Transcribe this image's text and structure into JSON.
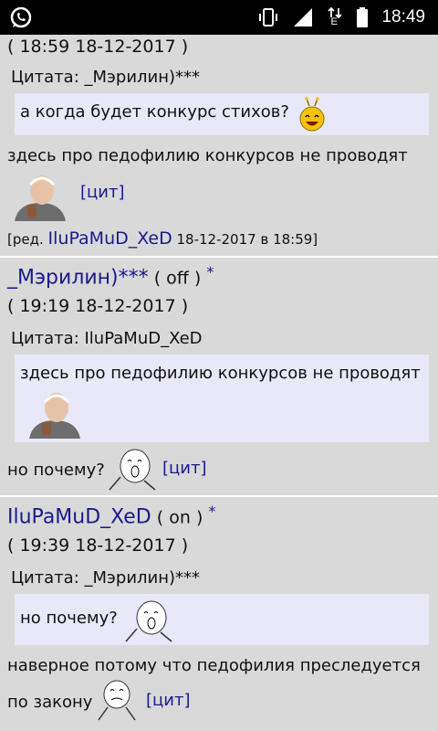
{
  "status_bar": {
    "time": "18:49",
    "icons": [
      "whatsapp-icon",
      "vibrate-icon",
      "signal-icon",
      "data-arrows-icon",
      "battery-icon"
    ],
    "network_letter": "E"
  },
  "posts": [
    {
      "datetime": "( 18:59 18-12-2017 )",
      "quote_label": "Цитата: _Мэрилин)***",
      "quote_text": "а когда будет конкурс стихов?",
      "body": "здесь про педофилию конкурсов не проводят",
      "cit": "[цит]",
      "edit_prefix": "[ред. ",
      "edit_user": "IluPaMuD_XeD",
      "edit_date": " 18-12-2017 в 18:59]"
    },
    {
      "author": "_Мэрилин)***",
      "online": "( off )",
      "star": "*",
      "datetime": "( 19:19 18-12-2017 )",
      "quote_label": "Цитата: IluPaMuD_XeD",
      "quote_text": "здесь про педофилию конкурсов не проводят",
      "body": "но почему?",
      "cit": "[цит]"
    },
    {
      "author": "IluPaMuD_XeD",
      "online": "( on )",
      "star": "*",
      "datetime": "( 19:39 18-12-2017 )",
      "quote_label": "Цитата: _Мэрилин)***",
      "quote_text": "но почему?",
      "body_line1": "наверное потому что педофилия преследуется",
      "body_line2": "по закону",
      "cit": "[цит]"
    }
  ],
  "colors": {
    "nick": "#1a1a8c",
    "quote_bg": "#e8e8f8",
    "page_bg": "#d9d9d9"
  }
}
